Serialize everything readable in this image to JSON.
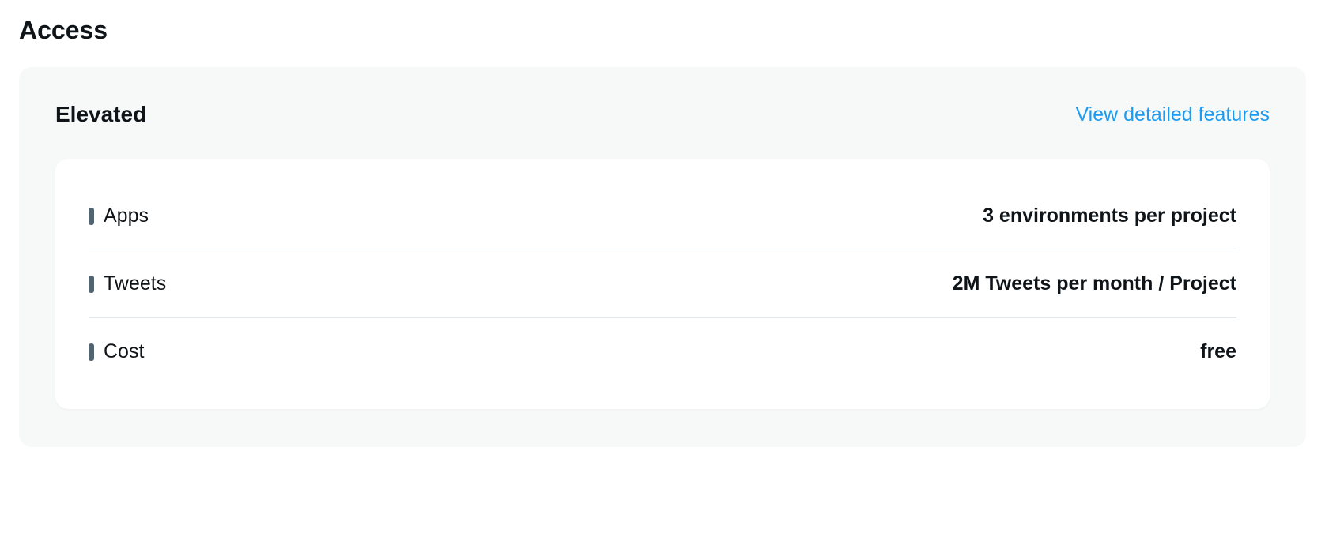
{
  "section": {
    "title": "Access"
  },
  "panel": {
    "tier": "Elevated",
    "link_label": "View detailed features"
  },
  "rows": [
    {
      "label": "Apps",
      "value": "3 environments per project"
    },
    {
      "label": "Tweets",
      "value": "2M Tweets per month / Project"
    },
    {
      "label": "Cost",
      "value": "free"
    }
  ]
}
